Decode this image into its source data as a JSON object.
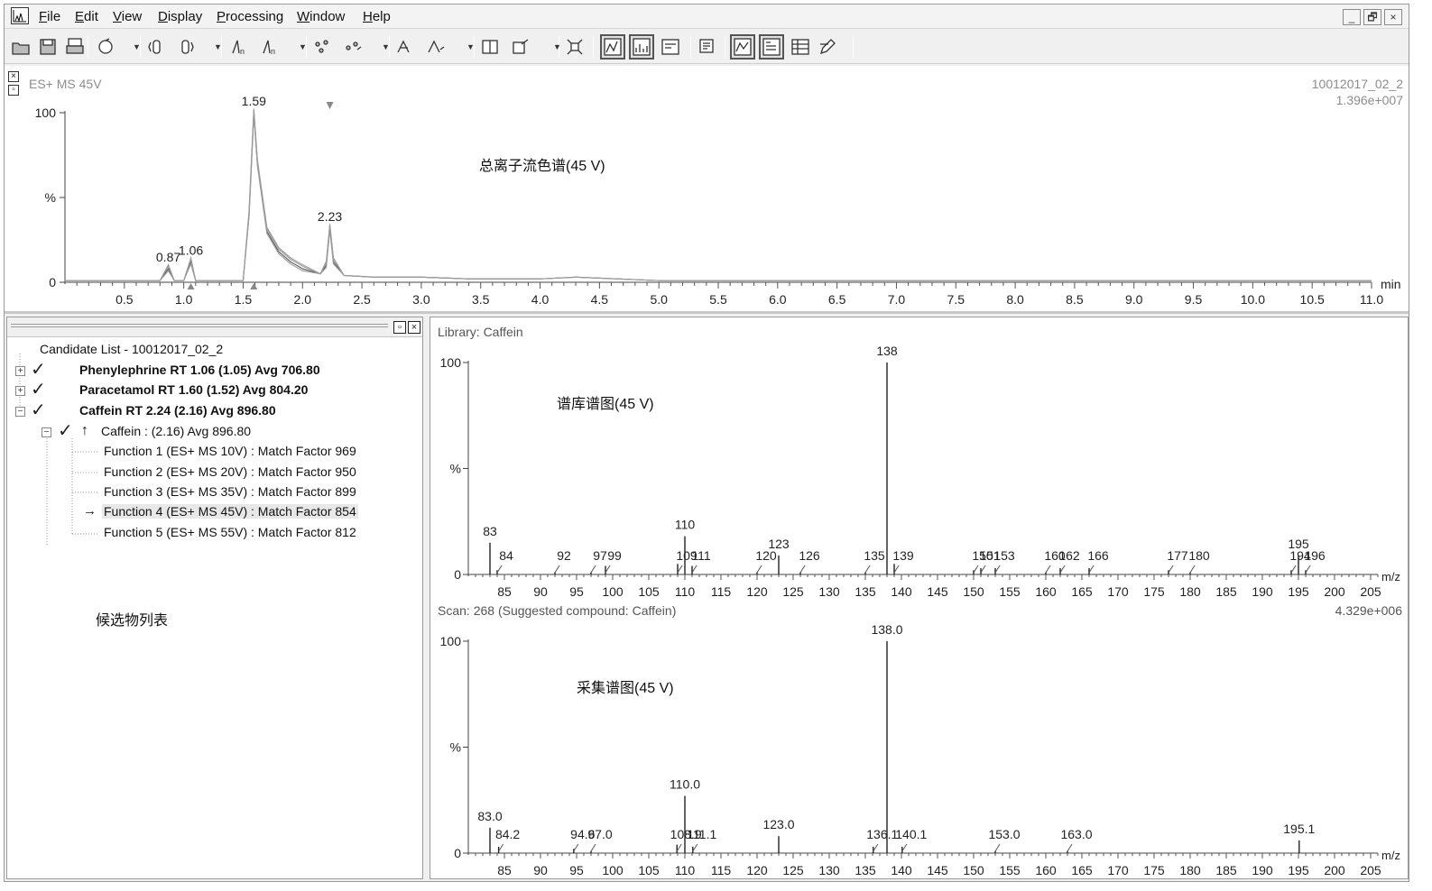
{
  "menu": {
    "items": [
      "File",
      "Edit",
      "View",
      "Display",
      "Processing",
      "Window",
      "Help"
    ],
    "window_buttons": [
      "_",
      "🗗",
      "×"
    ]
  },
  "toolbar": {
    "icons": [
      "open-folder-icon",
      "save-icon",
      "print-icon",
      "refresh-icon",
      "range-left-icon",
      "range-right-icon",
      "peak-left-icon",
      "peak-right-icon",
      "integrate-icon",
      "smooth-icon",
      "combine-icon",
      "subtract-icon",
      "library-icon",
      "export-icon",
      "zoom-fit-icon",
      "chromatogram-view-icon",
      "spectrum-view-icon",
      "list-view-icon",
      "report-icon",
      "trace-view-icon",
      "header-view-icon",
      "table-view-icon",
      "edit-icon"
    ]
  },
  "chromatogram": {
    "function_label": "ES+ MS  45V",
    "file_name": "10012017_02_2",
    "intensity": "1.396e+007",
    "annotation": "总离子流色谱(45 V)",
    "y_labels": [
      "100",
      "%",
      "0"
    ],
    "x_unit": "min"
  },
  "candidate_panel": {
    "annotation": "候选物列表",
    "root": "Candidate List - 10012017_02_2",
    "items": [
      {
        "label": "Phenylephrine RT 1.06 (1.05) Avg 706.80"
      },
      {
        "label": "Paracetamol RT 1.60 (1.52) Avg 804.20"
      },
      {
        "label": "Caffein RT 2.24 (2.16) Avg 896.80"
      }
    ],
    "sub_item": "Caffein : (2.16) Avg 896.80",
    "functions": [
      "Function 1 (ES+ MS  10V) : Match Factor 969",
      "Function 2 (ES+ MS  20V) : Match Factor 950",
      "Function 3 (ES+ MS  35V) : Match Factor 899",
      "Function 4 (ES+ MS  45V) : Match Factor 854",
      "Function 5 (ES+ MS  55V) : Match Factor 812"
    ]
  },
  "library_spectrum": {
    "title": "Library: Caffein",
    "annotation": "谱库谱图(45 V)",
    "y_labels": [
      "100",
      "%",
      "0"
    ],
    "x_unit": "m/z"
  },
  "scan_spectrum": {
    "title": "Scan: 268 (Suggested compound: Caffein)",
    "intensity": "4.329e+006",
    "annotation": "采集谱图(45 V)",
    "y_labels": [
      "100",
      "%",
      "0"
    ],
    "x_unit": "m/z"
  },
  "chart_data": [
    {
      "type": "line",
      "xlim": [
        0.0,
        11.0
      ],
      "ylim": [
        0,
        100
      ],
      "x_ticks": [
        "0.5",
        "1.0",
        "1.5",
        "2.0",
        "2.5",
        "3.0",
        "3.5",
        "4.0",
        "4.5",
        "5.0",
        "5.5",
        "6.0",
        "6.5",
        "7.0",
        "7.5",
        "8.0",
        "8.5",
        "9.0",
        "9.5",
        "10.0",
        "10.5",
        "11.0"
      ],
      "x_tick_values": [
        0.5,
        1.0,
        1.5,
        2.0,
        2.5,
        3.0,
        3.5,
        4.0,
        4.5,
        5.0,
        5.5,
        6.0,
        6.5,
        7.0,
        7.5,
        8.0,
        8.5,
        9.0,
        9.5,
        10.0,
        10.5,
        11.0
      ],
      "peaks": [
        {
          "x": 0.87,
          "y": 8,
          "label": "0.87"
        },
        {
          "x": 1.06,
          "y": 12,
          "label": "1.06"
        },
        {
          "x": 1.59,
          "y": 100,
          "label": "1.59"
        },
        {
          "x": 2.23,
          "y": 32,
          "label": "2.23"
        }
      ],
      "points": [
        [
          0.0,
          1
        ],
        [
          0.8,
          1
        ],
        [
          0.87,
          8
        ],
        [
          0.92,
          1
        ],
        [
          1.0,
          1
        ],
        [
          1.06,
          12
        ],
        [
          1.1,
          1
        ],
        [
          1.5,
          1
        ],
        [
          1.55,
          40
        ],
        [
          1.59,
          100
        ],
        [
          1.62,
          70
        ],
        [
          1.7,
          30
        ],
        [
          1.8,
          18
        ],
        [
          1.9,
          12
        ],
        [
          2.0,
          8
        ],
        [
          2.15,
          5
        ],
        [
          2.2,
          10
        ],
        [
          2.23,
          32
        ],
        [
          2.26,
          12
        ],
        [
          2.35,
          4
        ],
        [
          2.6,
          3
        ],
        [
          3.0,
          3
        ],
        [
          3.4,
          2
        ],
        [
          4.0,
          2
        ],
        [
          4.3,
          3
        ],
        [
          5.0,
          1
        ],
        [
          6.0,
          1
        ],
        [
          7.0,
          1
        ],
        [
          8.0,
          1
        ],
        [
          9.0,
          1
        ],
        [
          10.0,
          1
        ],
        [
          11.0,
          1
        ]
      ]
    },
    {
      "type": "bar",
      "xlim": [
        80,
        206
      ],
      "ylim": [
        0,
        100
      ],
      "values": [
        {
          "x": 83,
          "y": 15,
          "label": "83"
        },
        {
          "x": 84,
          "y": 2,
          "label": "84"
        },
        {
          "x": 92,
          "y": 1,
          "label": "92"
        },
        {
          "x": 97,
          "y": 1,
          "label": "97"
        },
        {
          "x": 99,
          "y": 4,
          "label": "99"
        },
        {
          "x": 109,
          "y": 5,
          "label": "109"
        },
        {
          "x": 110,
          "y": 18,
          "label": "110"
        },
        {
          "x": 111,
          "y": 4,
          "label": "111"
        },
        {
          "x": 120,
          "y": 1,
          "label": "120"
        },
        {
          "x": 123,
          "y": 9,
          "label": "123"
        },
        {
          "x": 126,
          "y": 1,
          "label": "126"
        },
        {
          "x": 135,
          "y": 1,
          "label": "135"
        },
        {
          "x": 138,
          "y": 100,
          "label": "138"
        },
        {
          "x": 139,
          "y": 5,
          "label": "139"
        },
        {
          "x": 150,
          "y": 2,
          "label": "150"
        },
        {
          "x": 151,
          "y": 3,
          "label": "151"
        },
        {
          "x": 153,
          "y": 3,
          "label": "153"
        },
        {
          "x": 160,
          "y": 1,
          "label": "160"
        },
        {
          "x": 162,
          "y": 3,
          "label": "162"
        },
        {
          "x": 166,
          "y": 3,
          "label": "166"
        },
        {
          "x": 177,
          "y": 2,
          "label": "177"
        },
        {
          "x": 180,
          "y": 1,
          "label": "180"
        },
        {
          "x": 194,
          "y": 2,
          "label": "194"
        },
        {
          "x": 195,
          "y": 9,
          "label": "195"
        },
        {
          "x": 196,
          "y": 2,
          "label": "196"
        }
      ],
      "x_ticks": [
        "85",
        "90",
        "95",
        "100",
        "105",
        "110",
        "115",
        "120",
        "125",
        "130",
        "135",
        "140",
        "145",
        "150",
        "155",
        "160",
        "165",
        "170",
        "175",
        "180",
        "185",
        "190",
        "195",
        "200",
        "205"
      ]
    },
    {
      "type": "bar",
      "xlim": [
        80,
        206
      ],
      "ylim": [
        0,
        100
      ],
      "values": [
        {
          "x": 83.0,
          "y": 12,
          "label": "83.0"
        },
        {
          "x": 84.2,
          "y": 3,
          "label": "84.2"
        },
        {
          "x": 94.6,
          "y": 2,
          "label": "94.6"
        },
        {
          "x": 97.0,
          "y": 1,
          "label": "97.0"
        },
        {
          "x": 108.9,
          "y": 4,
          "label": "108.9"
        },
        {
          "x": 110.0,
          "y": 27,
          "label": "110.0"
        },
        {
          "x": 111.1,
          "y": 3,
          "label": "111.1"
        },
        {
          "x": 123.0,
          "y": 8,
          "label": "123.0"
        },
        {
          "x": 136.1,
          "y": 3,
          "label": "136.1"
        },
        {
          "x": 138.0,
          "y": 100,
          "label": "138.0"
        },
        {
          "x": 140.1,
          "y": 3,
          "label": "140.1"
        },
        {
          "x": 153.0,
          "y": 1,
          "label": "153.0"
        },
        {
          "x": 163.0,
          "y": 1,
          "label": "163.0"
        },
        {
          "x": 195.1,
          "y": 6,
          "label": "195.1"
        }
      ],
      "x_ticks": [
        "85",
        "90",
        "95",
        "100",
        "105",
        "110",
        "115",
        "120",
        "125",
        "130",
        "135",
        "140",
        "145",
        "150",
        "155",
        "160",
        "165",
        "170",
        "175",
        "180",
        "185",
        "190",
        "195",
        "200",
        "205"
      ]
    }
  ]
}
